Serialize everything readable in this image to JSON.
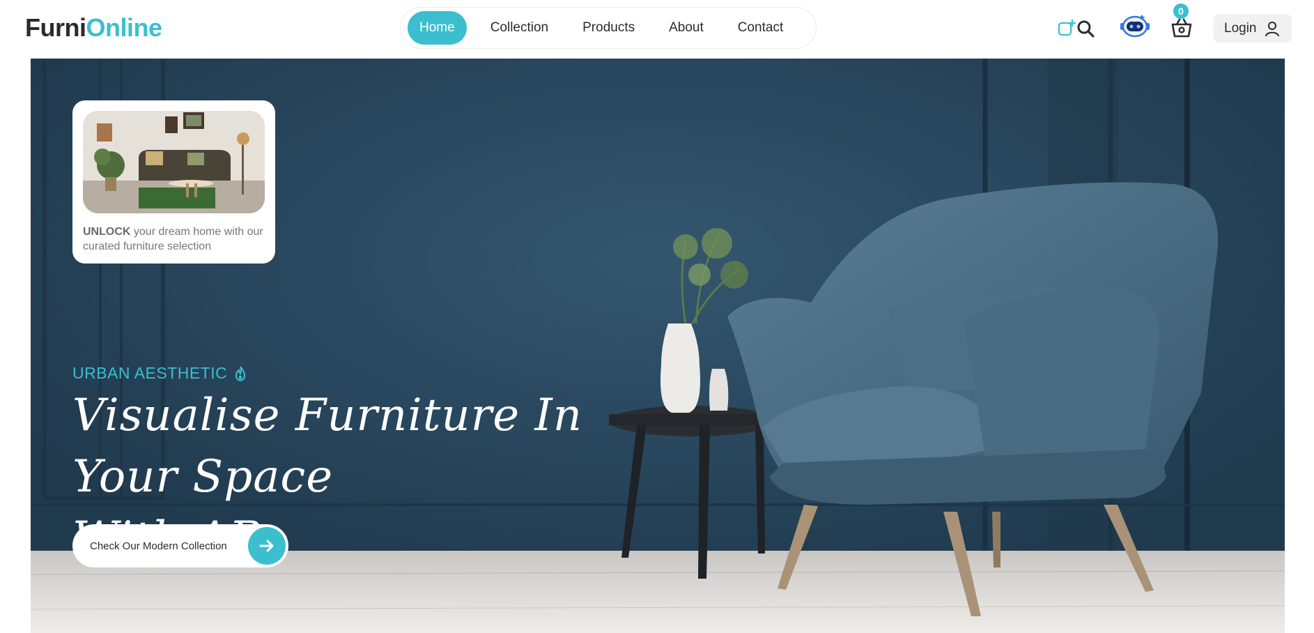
{
  "brand": {
    "name_part1": "Furni",
    "name_part2": "Online"
  },
  "nav": {
    "items": [
      {
        "label": "Home",
        "active": true
      },
      {
        "label": "Collection",
        "active": false
      },
      {
        "label": "Products",
        "active": false
      },
      {
        "label": "About",
        "active": false
      },
      {
        "label": "Contact",
        "active": false
      }
    ]
  },
  "header_actions": {
    "icons": [
      "ar-view-icon",
      "search-icon",
      "chatbot-icon",
      "cart-icon",
      "user-icon"
    ],
    "cart_count": "0",
    "login_label": "Login"
  },
  "hero": {
    "promo_card": {
      "bold": "UNLOCK",
      "text": "your dream home with our curated furniture selection"
    },
    "tagline": "URBAN AESTHETIC",
    "headline_line1": "Visualise Furniture In Your Space",
    "headline_line2": "With AR",
    "cta_label": "Check Our Modern Collection"
  },
  "colors": {
    "accent": "#3bbfcf",
    "wall": "#2b4b63",
    "text_dark": "#2b2b2b"
  }
}
